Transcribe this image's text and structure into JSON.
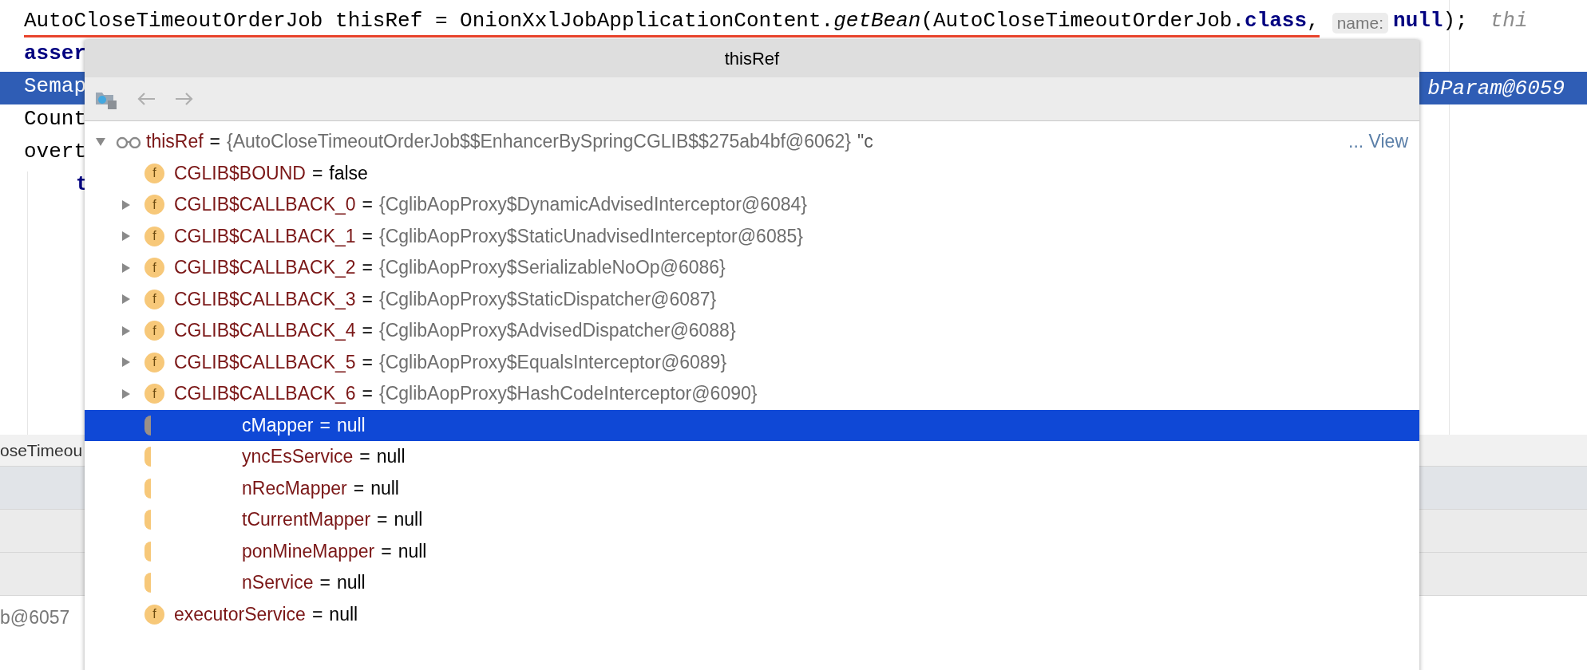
{
  "editor": {
    "lines": [
      {
        "selected": false,
        "indent": false,
        "segments": [
          {
            "text": "AutoCloseTimeoutOrderJob thisRef = OnionXxlJobApplicationContent.",
            "kind": "plain",
            "underlined": true
          },
          {
            "text": "getBean",
            "kind": "italic",
            "underlined": true
          },
          {
            "text": "(AutoCloseTimeoutOrderJob.",
            "kind": "plain",
            "underlined": true
          },
          {
            "text": "class",
            "kind": "keyword",
            "underlined": true
          },
          {
            "text": ",",
            "kind": "plain",
            "underlined": true
          },
          {
            "text": "name:",
            "kind": "hint",
            "underlined": false
          },
          {
            "text": "null",
            "kind": "keyword",
            "underlined": false
          },
          {
            "text": ");",
            "kind": "plain",
            "underlined": false
          },
          {
            "text": "thi",
            "kind": "comment",
            "underlined": false
          }
        ]
      },
      {
        "selected": false,
        "indent": false,
        "segments": [
          {
            "text": "asser",
            "kind": "keyword",
            "underlined": false
          }
        ]
      },
      {
        "selected": true,
        "indent": false,
        "segments": [
          {
            "text": "Semap",
            "kind": "plain",
            "underlined": false
          }
        ],
        "tail": "bParam@6059"
      },
      {
        "selected": false,
        "indent": false,
        "segments": [
          {
            "text": "Count",
            "kind": "plain",
            "underlined": false
          }
        ]
      },
      {
        "selected": false,
        "indent": false,
        "segments": [
          {
            "text": "overt",
            "kind": "plain",
            "underlined": false
          }
        ]
      },
      {
        "selected": false,
        "indent": true,
        "segments": [
          {
            "text": "t",
            "kind": "keyword",
            "underlined": false
          }
        ]
      }
    ]
  },
  "frames_panel": {
    "first_row": "oseTimeou",
    "footer": "b@6057"
  },
  "popup": {
    "title": "thisRef",
    "toolbar": [
      {
        "kind": "watch",
        "disabled": false
      },
      {
        "kind": "back",
        "disabled": true
      },
      {
        "kind": "forward",
        "disabled": true
      }
    ],
    "tree": {
      "name": "thisRef",
      "operator": "=",
      "value": "{AutoCloseTimeoutOrderJob$$EnhancerBySpringCGLIB$$275ab4bf@6062}",
      "suffix": "\"c",
      "link": "... View",
      "expanded": true,
      "children": [
        {
          "kind": "primitive",
          "badge": "f",
          "name": "CGLIB$BOUND",
          "operator": "=",
          "value": "false",
          "selected": false,
          "redacted": false
        },
        {
          "kind": "object",
          "badge": "f",
          "name": "CGLIB$CALLBACK_0",
          "operator": "=",
          "value": "{CglibAopProxy$DynamicAdvisedInterceptor@6084}",
          "selected": false,
          "redacted": false
        },
        {
          "kind": "object",
          "badge": "f",
          "name": "CGLIB$CALLBACK_1",
          "operator": "=",
          "value": "{CglibAopProxy$StaticUnadvisedInterceptor@6085}",
          "selected": false,
          "redacted": false
        },
        {
          "kind": "object",
          "badge": "f",
          "name": "CGLIB$CALLBACK_2",
          "operator": "=",
          "value": "{CglibAopProxy$SerializableNoOp@6086}",
          "selected": false,
          "redacted": false
        },
        {
          "kind": "object",
          "badge": "f",
          "name": "CGLIB$CALLBACK_3",
          "operator": "=",
          "value": "{CglibAopProxy$StaticDispatcher@6087}",
          "selected": false,
          "redacted": false
        },
        {
          "kind": "object",
          "badge": "f",
          "name": "CGLIB$CALLBACK_4",
          "operator": "=",
          "value": "{CglibAopProxy$AdvisedDispatcher@6088}",
          "selected": false,
          "redacted": false
        },
        {
          "kind": "object",
          "badge": "f",
          "name": "CGLIB$CALLBACK_5",
          "operator": "=",
          "value": "{CglibAopProxy$EqualsInterceptor@6089}",
          "selected": false,
          "redacted": false
        },
        {
          "kind": "object",
          "badge": "f",
          "name": "CGLIB$CALLBACK_6",
          "operator": "=",
          "value": "{CglibAopProxy$HashCodeInterceptor@6090}",
          "selected": false,
          "redacted": false
        },
        {
          "kind": "primitive",
          "name": "cMapper",
          "operator": "=",
          "value": "null",
          "selected": true,
          "redacted": true
        },
        {
          "kind": "primitive",
          "name": "yncEsService",
          "operator": "=",
          "value": "null",
          "selected": false,
          "redacted": true
        },
        {
          "kind": "primitive",
          "name": "nRecMapper",
          "operator": "=",
          "value": "null",
          "selected": false,
          "redacted": true
        },
        {
          "kind": "primitive",
          "name": "tCurrentMapper",
          "operator": "=",
          "value": "null",
          "selected": false,
          "redacted": true
        },
        {
          "kind": "primitive",
          "name": "ponMineMapper",
          "operator": "=",
          "value": "null",
          "selected": false,
          "redacted": true
        },
        {
          "kind": "primitive",
          "name": "nService",
          "operator": "=",
          "value": "null",
          "selected": false,
          "redacted": true
        },
        {
          "kind": "primitive",
          "badge": "f",
          "name": "executorService",
          "operator": "=",
          "value": "null",
          "selected": false,
          "redacted": false
        }
      ]
    }
  }
}
